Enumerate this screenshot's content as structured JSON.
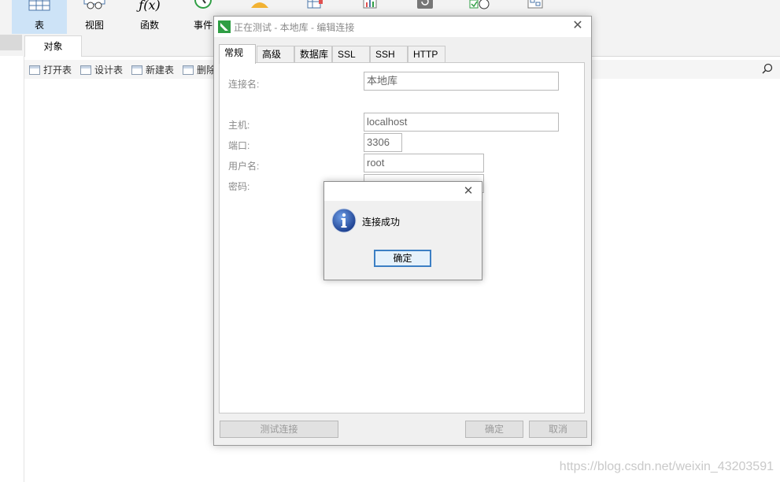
{
  "toolbar": {
    "items": [
      {
        "label": "表",
        "icon": "table-icon",
        "active": true
      },
      {
        "label": "视图",
        "icon": "view-icon"
      },
      {
        "label": "函数",
        "icon": "function-icon",
        "glyph": "ƒ(x)"
      },
      {
        "label": "事件",
        "icon": "event-icon"
      },
      {
        "label": "",
        "icon": "user-icon"
      },
      {
        "label": "",
        "icon": "query-icon"
      },
      {
        "label": "",
        "icon": "report-icon"
      },
      {
        "label": "",
        "icon": "backup-icon"
      },
      {
        "label": "",
        "icon": "schedule-icon"
      },
      {
        "label": "",
        "icon": "model-icon"
      }
    ]
  },
  "object_tab": {
    "label": "对象"
  },
  "subbar": {
    "open_table": "打开表",
    "design_table": "设计表",
    "new_table": "新建表",
    "delete": "删除"
  },
  "dialog": {
    "title": "正在测试 - 本地库 - 编辑连接",
    "tabs": [
      "常规",
      "高级",
      "数据库",
      "SSL",
      "SSH",
      "HTTP"
    ],
    "active_tab": "常规",
    "fields": {
      "connection_name": {
        "label": "连接名:",
        "value": "本地库"
      },
      "host": {
        "label": "主机:",
        "value": "localhost"
      },
      "port": {
        "label": "端口:",
        "value": "3306"
      },
      "username": {
        "label": "用户名:",
        "value": "root"
      },
      "password": {
        "label": "密码:",
        "value": ""
      }
    },
    "buttons": {
      "test": "测试连接",
      "ok": "确定",
      "cancel": "取消"
    }
  },
  "message_box": {
    "text": "连接成功",
    "ok": "确定",
    "icon": "info-icon"
  },
  "watermark": "https://blog.csdn.net/weixin_43203591",
  "colors": {
    "accent": "#3c7fc4",
    "active_tab": "#cde3f7",
    "navicat_green": "#2f9e44"
  }
}
